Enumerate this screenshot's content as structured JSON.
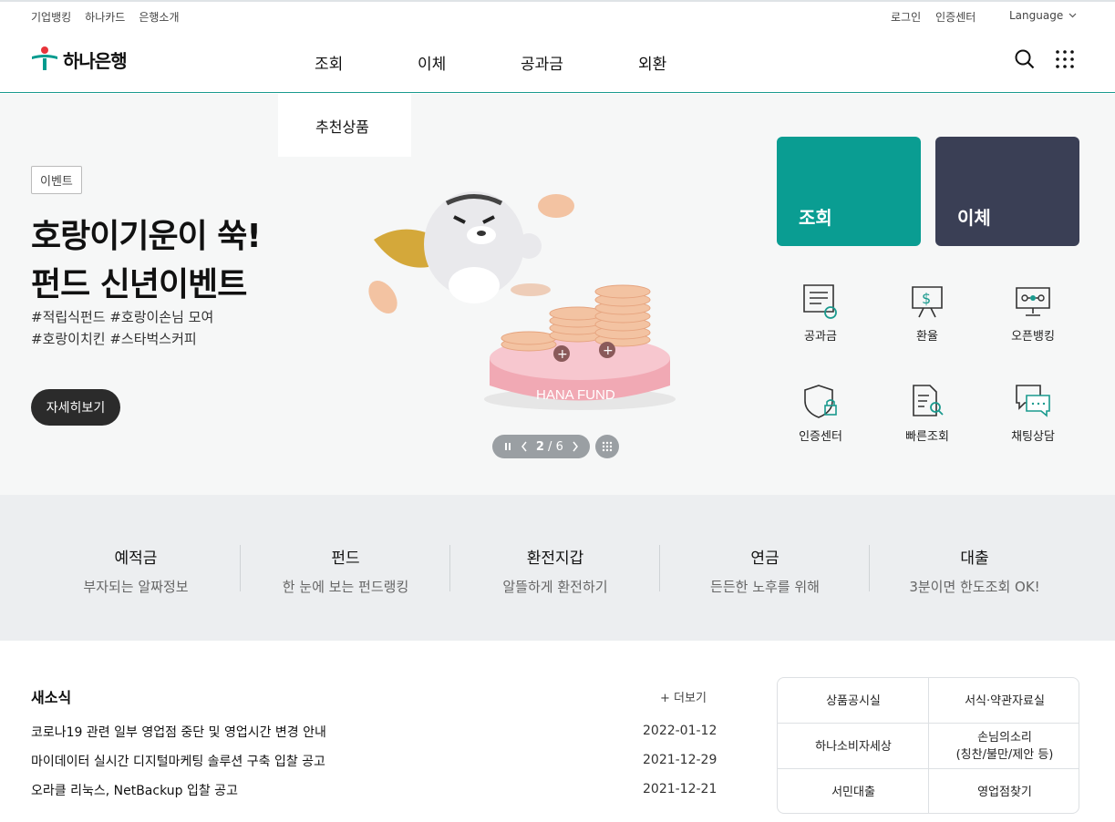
{
  "utility": {
    "left_links": [
      "기업뱅킹",
      "하나카드",
      "은행소개"
    ],
    "login": "로그인",
    "cert_center": "인증센터",
    "language": "Language"
  },
  "header": {
    "logo_text": "하나은행",
    "menu": [
      "조회",
      "이체",
      "공과금",
      "외환"
    ],
    "dropdown_item": "추천상품"
  },
  "hero": {
    "badge": "이벤트",
    "title_line1": "호랑이기운이 쑥!",
    "title_line2": "펀드 신년이벤트",
    "tags_line1": "#적립식펀드 #호랑이손님 모여",
    "tags_line2": "#호랑이치킨 #스타벅스커피",
    "detail_button": "자세히보기",
    "pedestal_text": "HANA FUND",
    "pager_current": "2",
    "pager_total": "6"
  },
  "quick": {
    "tile1": "조회",
    "tile2": "이체",
    "icons": [
      "공과금",
      "환율",
      "오픈뱅킹",
      "인증센터",
      "빠른조회",
      "채팅상담"
    ]
  },
  "categories": [
    {
      "title": "예적금",
      "sub": "부자되는 알짜정보"
    },
    {
      "title": "펀드",
      "sub": "한 눈에 보는 펀드랭킹"
    },
    {
      "title": "환전지갑",
      "sub": "알뜰하게 환전하기"
    },
    {
      "title": "연금",
      "sub": "든든한 노후를 위해"
    },
    {
      "title": "대출",
      "sub": "3분이면 한도조회 OK!"
    }
  ],
  "news": {
    "title": "새소식",
    "more": "+ 더보기",
    "items": [
      {
        "text": "코로나19 관련 일부 영업점 중단 및 영업시간 변경 안내",
        "date": "2022-01-12"
      },
      {
        "text": "마이데이터 실시간 디지털마케팅 솔루션 구축 입찰 공고",
        "date": "2021-12-29"
      },
      {
        "text": "오라클 리눅스, NetBackup 입찰 공고",
        "date": "2021-12-21"
      }
    ]
  },
  "quick_links": {
    "product_notice": "상품공시실",
    "forms": "서식·약관자료실",
    "consumer": "하나소비자세상",
    "voice_line1": "손님의소리",
    "voice_line2": "(칭찬/불만/제안 등)",
    "loan": "서민대출",
    "branch": "영업점찾기"
  },
  "colors": {
    "brand_teal": "#009b8e",
    "tile_navy": "#3a3f55",
    "pager_gray": "#9a9fa3"
  }
}
